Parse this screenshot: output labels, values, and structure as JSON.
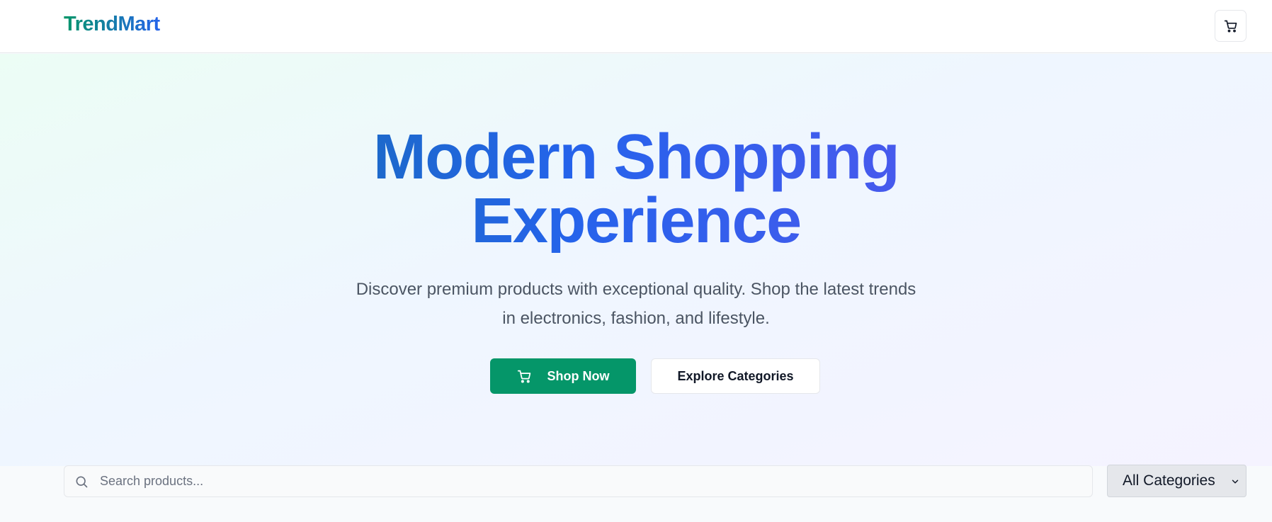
{
  "header": {
    "brand": "TrendMart",
    "cart_icon": "shopping-cart-icon"
  },
  "hero": {
    "title": "Modern Shopping Experience",
    "subtitle": "Discover premium products with exceptional quality. Shop the latest trends in electronics, fashion, and lifestyle.",
    "primary_button": {
      "label": "Shop Now",
      "icon": "shopping-cart-icon"
    },
    "secondary_button": {
      "label": "Explore Categories"
    }
  },
  "filters": {
    "search": {
      "placeholder": "Search products...",
      "value": "",
      "icon": "search-icon"
    },
    "category": {
      "selected": "All Categories",
      "icon": "chevron-down-icon"
    }
  },
  "colors": {
    "brand_green": "#059669",
    "brand_blue": "#2563eb",
    "accent_violet": "#6d4ff0"
  }
}
